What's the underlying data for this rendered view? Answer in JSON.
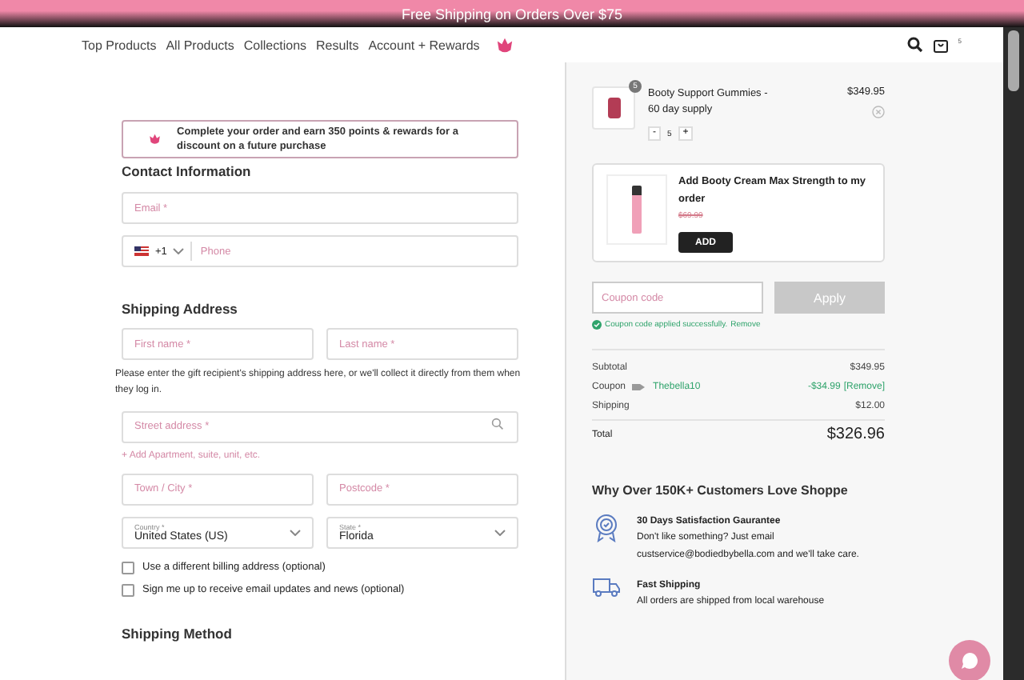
{
  "banner": {
    "text": "Free Shipping on Orders Over $75"
  },
  "nav": {
    "items": [
      "Top Products",
      "All Products",
      "Collections",
      "Results",
      "Account + Rewards"
    ],
    "cart_count": "5"
  },
  "rewards": {
    "text": "Complete your order and earn 350 points & rewards for a discount on a future purchase"
  },
  "contact": {
    "heading": "Contact Information",
    "email": {
      "placeholder": "Email *"
    },
    "phone": {
      "code": "+1",
      "placeholder": "Phone"
    }
  },
  "shipping_address": {
    "heading": "Shipping Address",
    "first_name": {
      "placeholder": "First name *"
    },
    "last_name": {
      "placeholder": "Last name *"
    },
    "note": "Please enter the gift recipient's shipping address here, or we'll collect it directly from them when they log in.",
    "street": {
      "placeholder": "Street address *"
    },
    "add_line": "+ Add Apartment, suite, unit, etc.",
    "city": {
      "placeholder": "Town / City *"
    },
    "postcode": {
      "placeholder": "Postcode *"
    },
    "country": {
      "label": "Country *",
      "value": "United States (US)"
    },
    "state": {
      "label": "State *",
      "value": "Florida"
    },
    "options": [
      {
        "label": "Use a different billing address (optional)",
        "checked": false
      },
      {
        "label": "Sign me up to receive email updates and news (optional)",
        "checked": false
      }
    ]
  },
  "shipping_method": {
    "heading": "Shipping Method"
  },
  "cart": {
    "item": {
      "badge": "5",
      "name": "Booty Support Gummies - 60 day supply",
      "price": "$349.95",
      "quantity": "5",
      "minus": "-",
      "plus": "+"
    },
    "upsell": {
      "title": "Add Booty Cream Max Strength to my order",
      "price": "$69.99",
      "button": "ADD"
    },
    "coupon": {
      "placeholder": "Coupon code",
      "button": "Apply",
      "message": "Coupon code applied successfully.",
      "remove_link": "Remove"
    },
    "summary": [
      {
        "label": "Subtotal",
        "value": "$349.95"
      },
      {
        "label": "Coupon",
        "code": "Thebella10",
        "value": "-$34.99",
        "remove": "[Remove]"
      },
      {
        "label": "Shipping",
        "value": "$12.00"
      }
    ],
    "total": {
      "label": "Total",
      "value": "$326.96"
    }
  },
  "why": {
    "heading": "Why Over 150K+ Customers Love Shoppe",
    "features": [
      {
        "kind": "badge",
        "title": "30 Days Satisfaction Gaurantee",
        "text": "Don't like something? Just email custservice@bodiedbybella.com and we'll take care."
      },
      {
        "kind": "truck",
        "title": "Fast Shipping",
        "text": "All orders are shipped from local warehouse"
      }
    ]
  }
}
